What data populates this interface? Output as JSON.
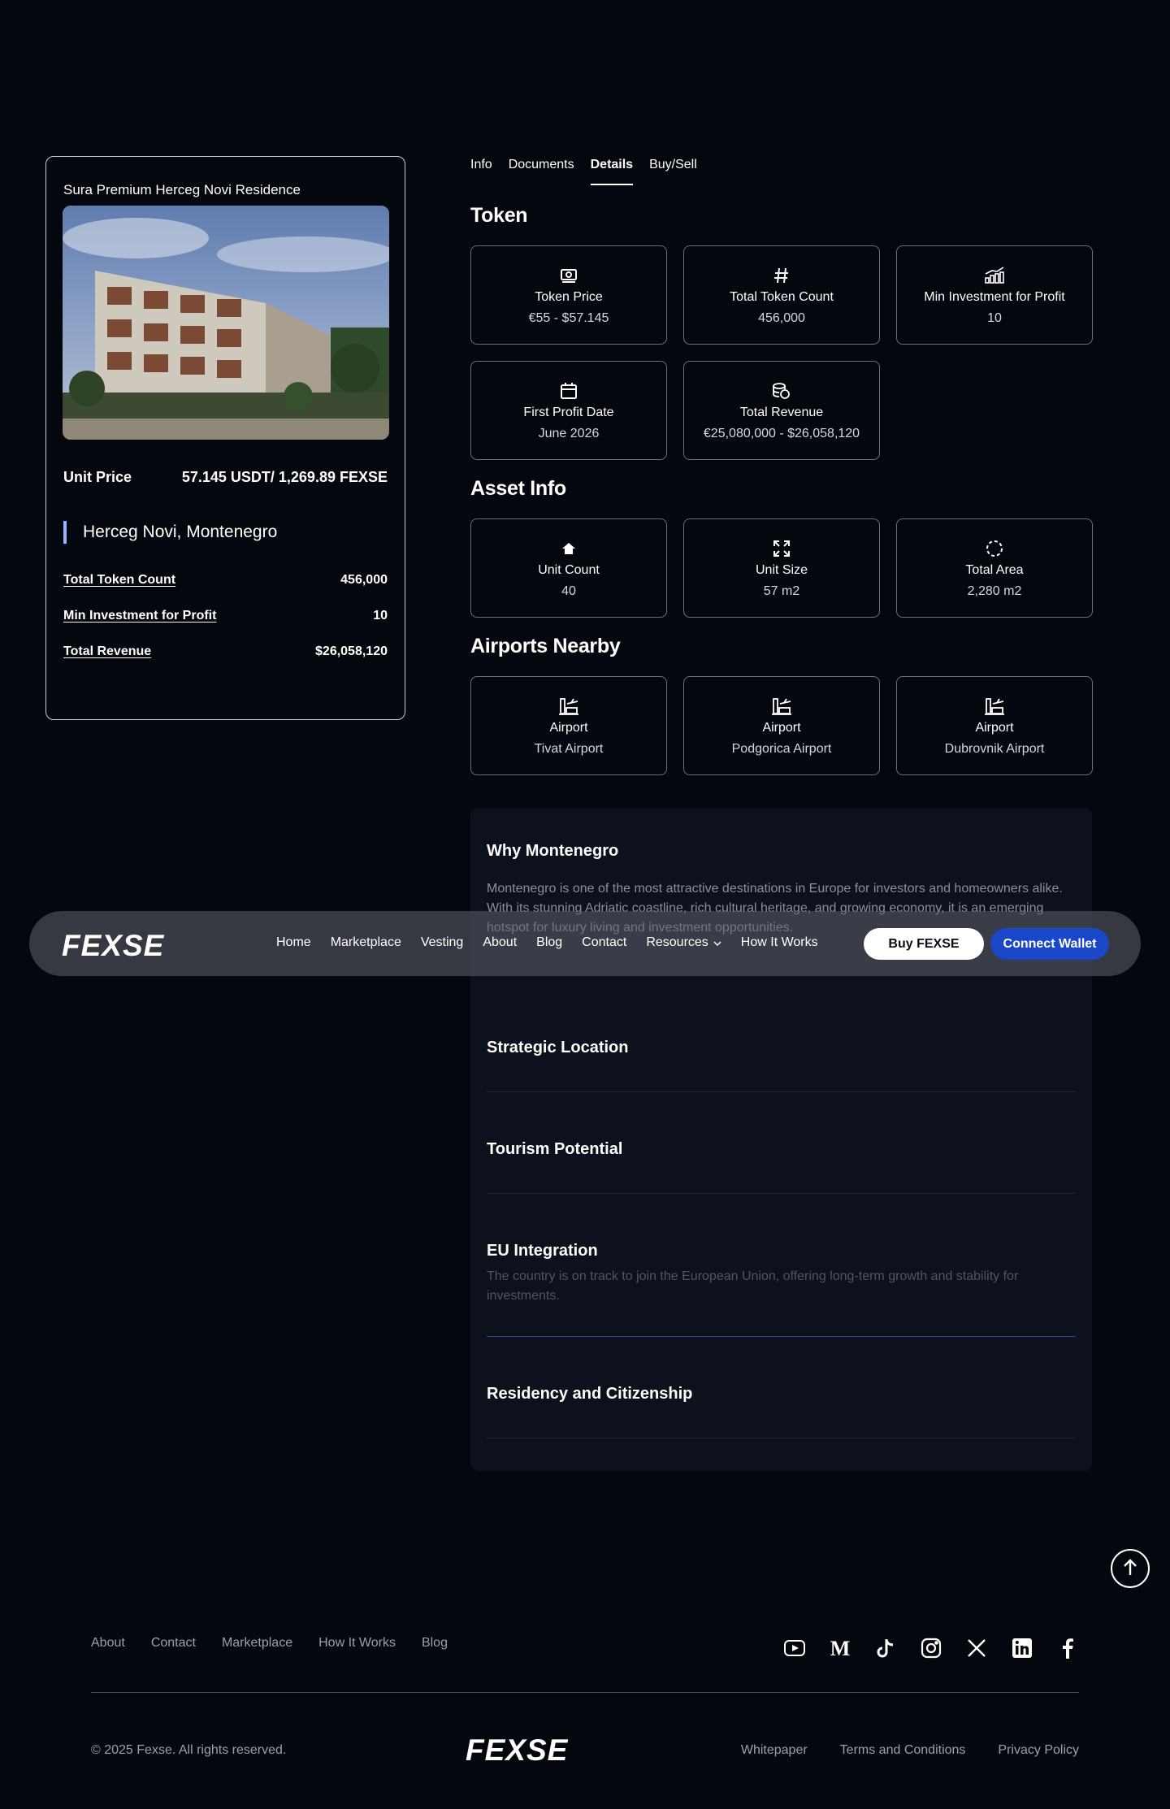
{
  "property": {
    "title": "Sura Premium Herceg Novi Residence",
    "image_alt": "Residence building render",
    "unit_price_label": "Unit Price",
    "unit_price_value": "57.145 USDT/ 1,269.89 FEXSE",
    "location": "Herceg Novi, Montenegro",
    "rows": [
      {
        "label": "Total Token Count",
        "value": "456,000"
      },
      {
        "label": "Min Investment for Profit",
        "value": "10"
      },
      {
        "label": "Total Revenue",
        "value": "$26,058,120"
      }
    ]
  },
  "tabs": [
    {
      "label": "Info"
    },
    {
      "label": "Documents"
    },
    {
      "label": "Details",
      "active": true
    },
    {
      "label": "Buy/Sell"
    }
  ],
  "token": {
    "heading": "Token",
    "cards": [
      {
        "icon": "banknote-icon",
        "title": "Token Price",
        "value": "€55  -  $57.145"
      },
      {
        "icon": "hash-icon",
        "title": "Total Token Count",
        "value": "456,000"
      },
      {
        "icon": "chart-icon",
        "title": "Min Investment for Profit",
        "value": "10"
      },
      {
        "icon": "calendar-icon",
        "title": "First Profit Date",
        "value": "June 2026"
      },
      {
        "icon": "coins-icon",
        "title": "Total Revenue",
        "value": "€25,080,000  -  $26,058,120"
      }
    ]
  },
  "asset": {
    "heading": "Asset Info",
    "cards": [
      {
        "icon": "home-icon",
        "title": "Unit Count",
        "value": "40"
      },
      {
        "icon": "expand-icon",
        "title": "Unit Size",
        "value": "57 m2"
      },
      {
        "icon": "dashed-circle-icon",
        "title": "Total Area",
        "value": "2,280 m2"
      }
    ]
  },
  "airports": {
    "heading": "Airports Nearby",
    "cards": [
      {
        "icon": "airport-icon",
        "title": "Airport",
        "value": "Tivat Airport"
      },
      {
        "icon": "airport-icon",
        "title": "Airport",
        "value": "Podgorica Airport"
      },
      {
        "icon": "airport-icon",
        "title": "Airport",
        "value": "Dubrovnik Airport"
      }
    ]
  },
  "why": {
    "title": "Why Montenegro",
    "text": "Montenegro is one of the most attractive destinations in Europe for investors and homeowners alike. With its stunning Adriatic coastline, rich cultural heritage, and growing economy, it is an emerging hotspot for luxury living and investment opportunities.",
    "items": [
      {
        "title": "Strategic Location",
        "desc": ""
      },
      {
        "title": "Tourism Potential",
        "desc": ""
      },
      {
        "title": "EU Integration",
        "desc": "The country is on track to join the European Union, offering long-term growth and stability for investments."
      },
      {
        "title": "Residency and Citizenship",
        "desc": ""
      }
    ]
  },
  "navbar": {
    "logo": "FEXSE",
    "links": [
      "Home",
      "Marketplace",
      "Vesting",
      "About",
      "Blog",
      "Contact",
      "Resources",
      "How It Works"
    ],
    "buy_label": "Buy FEXSE",
    "connect_label": "Connect Wallet"
  },
  "footer": {
    "links": [
      "About",
      "Contact",
      "Marketplace",
      "How It Works",
      "Blog"
    ],
    "socials": [
      "youtube-icon",
      "medium-icon",
      "tiktok-icon",
      "instagram-icon",
      "x-icon",
      "linkedin-icon",
      "facebook-icon"
    ],
    "copyright": "© 2025 Fexse. All rights reserved.",
    "logo": "FEXSE",
    "legal": [
      "Whitepaper",
      "Terms and Conditions",
      "Privacy Policy"
    ]
  }
}
